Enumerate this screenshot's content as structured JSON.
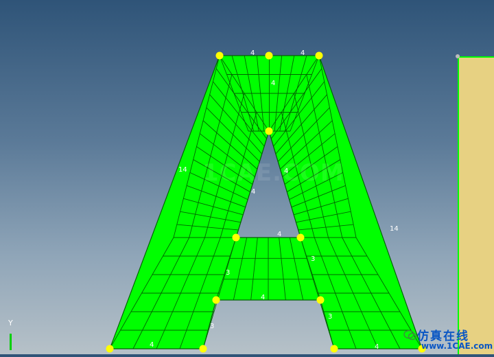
{
  "viewport": {
    "background_top": "#2f5478",
    "background_bottom": "#b6c1c8",
    "mesh_color": "#00ff00",
    "mesh_line_color": "#006400",
    "node_color": "#ffff00",
    "side_part_color": "#e7d182"
  },
  "edge_labels": [
    "4",
    "4",
    "4",
    "14",
    "4",
    "4",
    "4",
    "14",
    "3",
    "3",
    "4",
    "3",
    "3",
    "4",
    "4"
  ],
  "watermark": "1CAE.COM",
  "axis": {
    "label": "Y"
  },
  "brand": {
    "chinese": "仿真在线",
    "url": "www.1CAE.com"
  }
}
